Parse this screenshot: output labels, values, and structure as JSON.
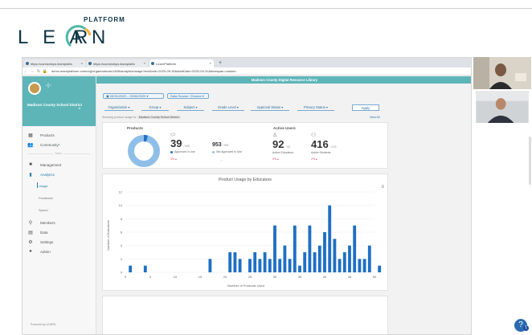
{
  "logo": {
    "word": "LEARN",
    "platform": "PLATFORM"
  },
  "browser": {
    "tabs": [
      {
        "title": "https://connectsys.learnplatfo"
      },
      {
        "title": "https://connectsys.learnplatfo"
      },
      {
        "title": "LearnPlatform"
      }
    ],
    "url": "demo.learnplatform.com/org/organizations/1485/analytics/usage?endDate=2020-09-30&startDate=2020-05-31&timespan=custom"
  },
  "sidebar": {
    "district": "Madison County School District",
    "items": [
      {
        "label": "Products",
        "icon": "grid-icon"
      },
      {
        "label": "Community",
        "icon": "community-icon"
      },
      {
        "label": "Management",
        "icon": "briefcase-icon"
      },
      {
        "label": "Analytics",
        "icon": "bar-chart-icon"
      },
      {
        "label": "Members",
        "icon": "person-icon"
      },
      {
        "label": "Data",
        "icon": "database-icon"
      },
      {
        "label": "Settings",
        "icon": "gear-icon"
      },
      {
        "label": "Admin",
        "icon": "admin-icon"
      }
    ],
    "divider_label": "Track",
    "analytics_subitems": [
      "Usage",
      "Feedback",
      "Spend"
    ],
    "powered_by": "Powered by LEARN"
  },
  "banner": "Madison County Digital Resource Library",
  "date_range": {
    "start": "05/31/2020",
    "end": "09/30/2020",
    "source": "Data Source: Chrome"
  },
  "filters": [
    "Organization",
    "Group",
    "Subject",
    "Grade Level",
    "Approval Status",
    "Privacy Status"
  ],
  "apply_label": "Apply",
  "showing": {
    "prefix": "Showing product usage for",
    "chip": "Madison County School District"
  },
  "view_all": "View All",
  "products_card": {
    "title": "Products",
    "approved": {
      "value": "39",
      "of": "/ 992",
      "label": "Approved in Use",
      "pct": "3% ▴"
    },
    "not_approved": {
      "value": "953",
      "of": "/ 992",
      "label": "Not Approved in Use"
    },
    "donut": {
      "approved_fraction": 0.04
    }
  },
  "active_users_card": {
    "title": "Active Users",
    "educators": {
      "value": "92",
      "of": "/ 92",
      "label": "Active Educators",
      "pct": "0% ▴"
    },
    "students": {
      "value": "416",
      "of": "/ 473",
      "label": "Active Students",
      "pct": "2% ▴"
    }
  },
  "colors": {
    "teal": "#5eb5b8",
    "blue": "#1f6fc5",
    "light_blue": "#8fbfe8",
    "red": "#d84a5a"
  },
  "chart_data": {
    "type": "bar",
    "title": "Product Usage by Educators",
    "xlabel": "Number of Products Used",
    "ylabel": "Number of Educators",
    "xlim": [
      0,
      50
    ],
    "ylim": [
      0,
      12
    ],
    "xticks": [
      0,
      5,
      10,
      15,
      20,
      25,
      30,
      35,
      40,
      45,
      50
    ],
    "yticks": [
      0,
      2,
      4,
      6,
      8,
      10,
      12
    ],
    "x": [
      1,
      4,
      17,
      21,
      22,
      23,
      25,
      26,
      27,
      28,
      29,
      30,
      31,
      32,
      33,
      34,
      35,
      36,
      37,
      38,
      39,
      40,
      41,
      42,
      43,
      44,
      45,
      46,
      47,
      48,
      49,
      51
    ],
    "values": [
      1,
      1,
      2,
      3,
      3,
      2,
      2,
      3,
      2,
      3,
      2,
      7,
      2,
      4,
      2,
      7,
      1,
      3,
      7,
      3,
      4,
      6,
      10,
      5,
      2,
      3,
      4,
      7,
      2,
      2,
      4,
      1
    ]
  }
}
